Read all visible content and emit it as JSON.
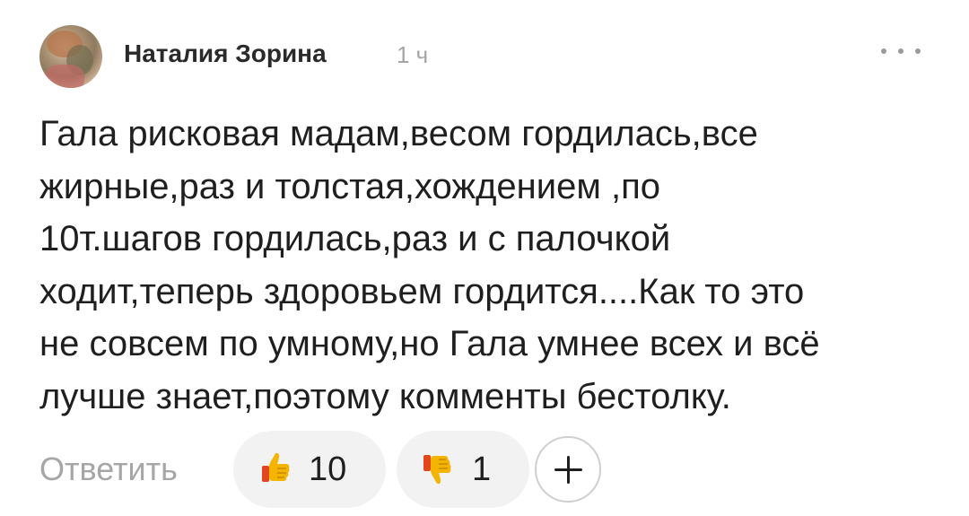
{
  "comment": {
    "author": {
      "name": "Наталия Зорина",
      "time": "1 ч"
    },
    "text_lines": [
      "Гала рисковая мадам,весом гордилась,все",
      "жирные,раз и толстая,хождением ,по",
      "10т.шагов гордилась,раз и с палочкой",
      "ходит,теперь здоровьем гордится....Как то это",
      "не совсем по умному,но Гала умнее всех и всё",
      "лучше знает,поэтому комменты бестолку."
    ],
    "actions": {
      "reply_label": "Ответить",
      "likes": {
        "icon": "thumbs-up-emoji-icon",
        "count": "10"
      },
      "dislikes": {
        "icon": "thumbs-down-emoji-icon",
        "count": "1"
      },
      "add_reaction_icon": "plus-icon"
    },
    "more_icon": "more-horizontal-icon"
  },
  "colors": {
    "text": "#1f1f1f",
    "muted": "#a6a6a6",
    "pill_background": "#f2f2f2",
    "thumb_yellow": "#f5b400",
    "thumb_red": "#e2461f"
  }
}
